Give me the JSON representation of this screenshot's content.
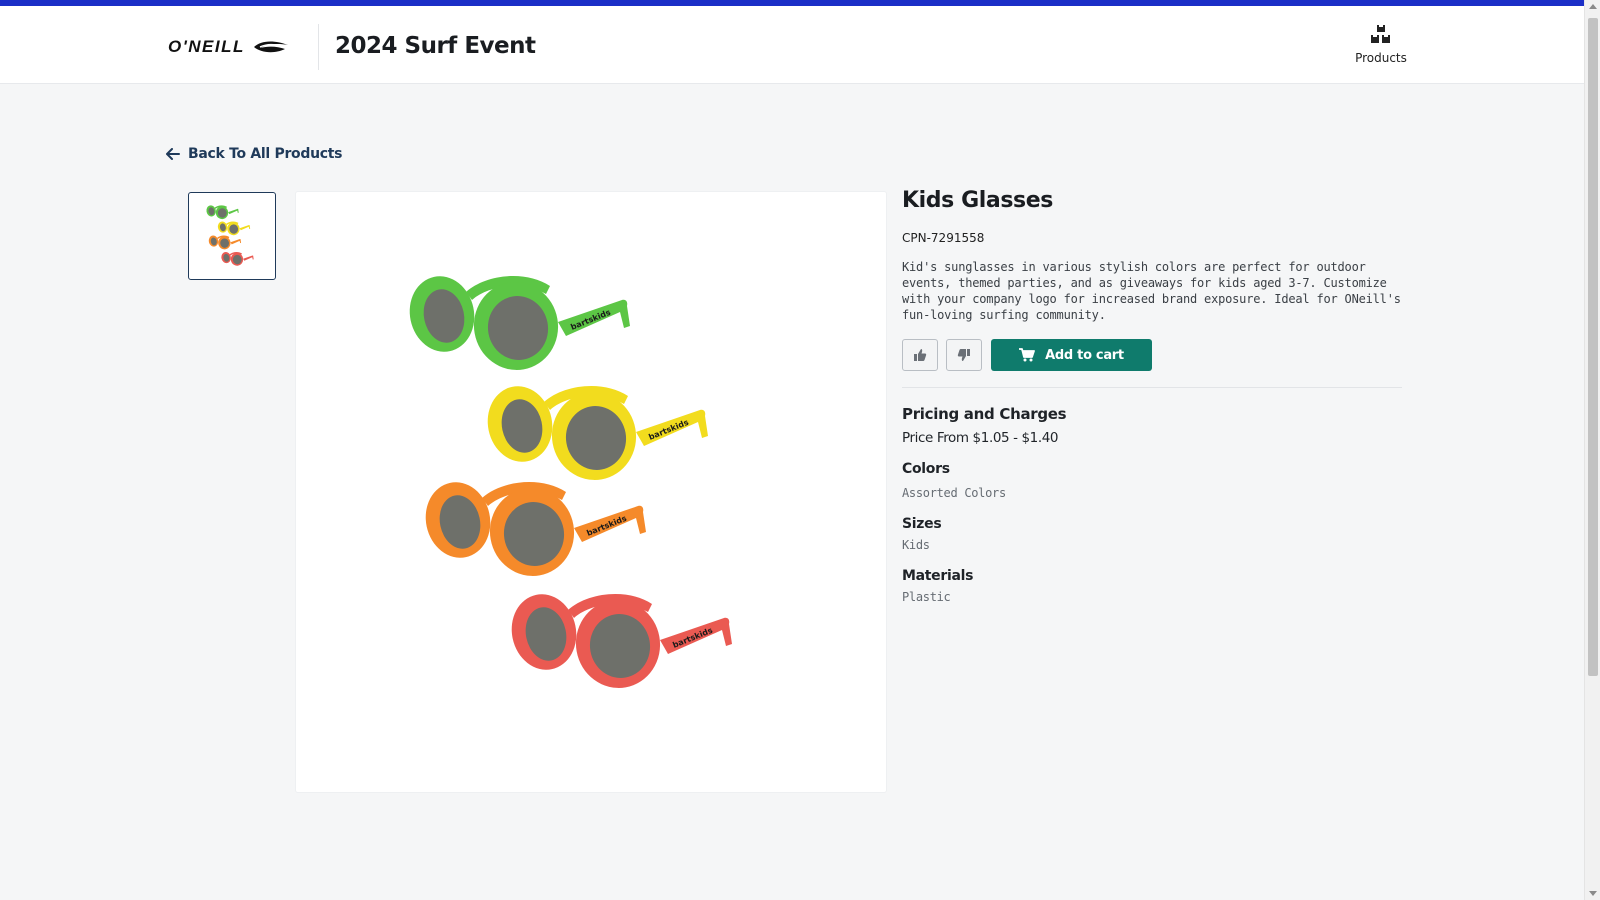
{
  "header": {
    "brand": "O'NEILL",
    "event_title": "2024 Surf Event",
    "nav_products_label": "Products"
  },
  "navigation": {
    "back_label": "Back To All Products"
  },
  "product": {
    "title": "Kids Glasses",
    "sku": "CPN-7291558",
    "description": "Kid's sunglasses in various stylish colors are perfect for outdoor events, themed parties, and as giveaways for kids aged 3-7. Customize with your company logo for increased brand exposure. Ideal for ONeill's fun-loving surfing community.",
    "add_to_cart_label": "Add to cart",
    "glasses_brand_mark": "bartskids",
    "glasses_colors": [
      "#5cc645",
      "#f2dc1e",
      "#f58a2a",
      "#ea5a52"
    ]
  },
  "pricing": {
    "heading": "Pricing and Charges",
    "price_text": "Price From $1.05 - $1.40"
  },
  "attributes": [
    {
      "label": "Colors",
      "value": "Assorted Colors"
    },
    {
      "label": "Sizes",
      "value": "Kids"
    },
    {
      "label": "Materials",
      "value": "Plastic"
    }
  ],
  "colors": {
    "accent_bar": "#1b2fc7",
    "cart_button": "#0f7b6c",
    "link": "#1f3a5a"
  },
  "icons": {
    "products": "boxes-icon",
    "back": "arrow-left-icon",
    "like": "thumbs-up-icon",
    "dislike": "thumbs-down-icon",
    "cart": "cart-icon"
  }
}
